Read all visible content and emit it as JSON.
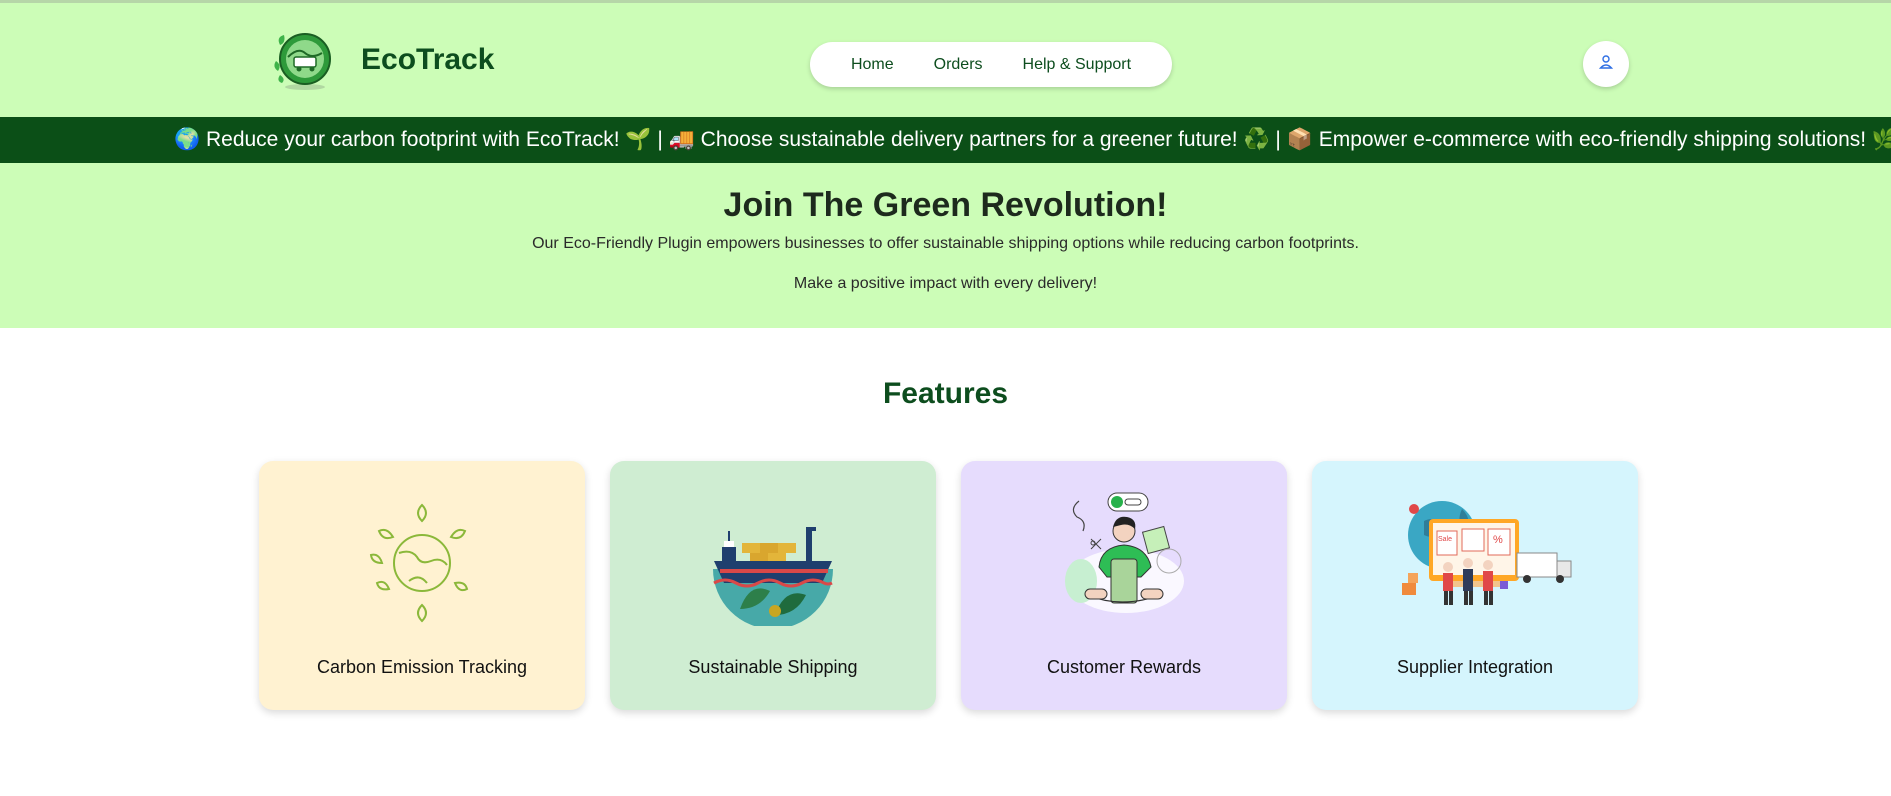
{
  "header": {
    "brand": "EcoTrack",
    "nav": [
      {
        "label": "Home"
      },
      {
        "label": "Orders"
      },
      {
        "label": "Help & Support"
      }
    ]
  },
  "ticker": {
    "text": "🌍 Reduce your carbon footprint with EcoTrack! 🌱 | 🚚 Choose sustainable delivery partners for a greener future! ♻️ | 📦 Empower e-commerce with eco-friendly shipping solutions! 🌿 | 🌍 R"
  },
  "hero": {
    "title": "Join The Green Revolution!",
    "description": "Our Eco-Friendly Plugin empowers businesses to offer sustainable shipping options while reducing carbon footprints.",
    "cta": "Make a positive impact with every delivery!"
  },
  "features": {
    "title": "Features",
    "cards": [
      {
        "label": "Carbon Emission Tracking",
        "icon": "globe-leaves-icon",
        "bg": "#fff2d1"
      },
      {
        "label": "Sustainable Shipping",
        "icon": "cargo-ship-icon",
        "bg": "#cfedd2"
      },
      {
        "label": "Customer Rewards",
        "icon": "rewards-person-icon",
        "bg": "#e6dcfd"
      },
      {
        "label": "Supplier Integration",
        "icon": "supplier-network-icon",
        "bg": "#d5f5fd"
      }
    ]
  },
  "colors": {
    "header_bg": "#ccfdb7",
    "ticker_bg": "#0b4f17",
    "brand_text": "#0d4d1e"
  }
}
